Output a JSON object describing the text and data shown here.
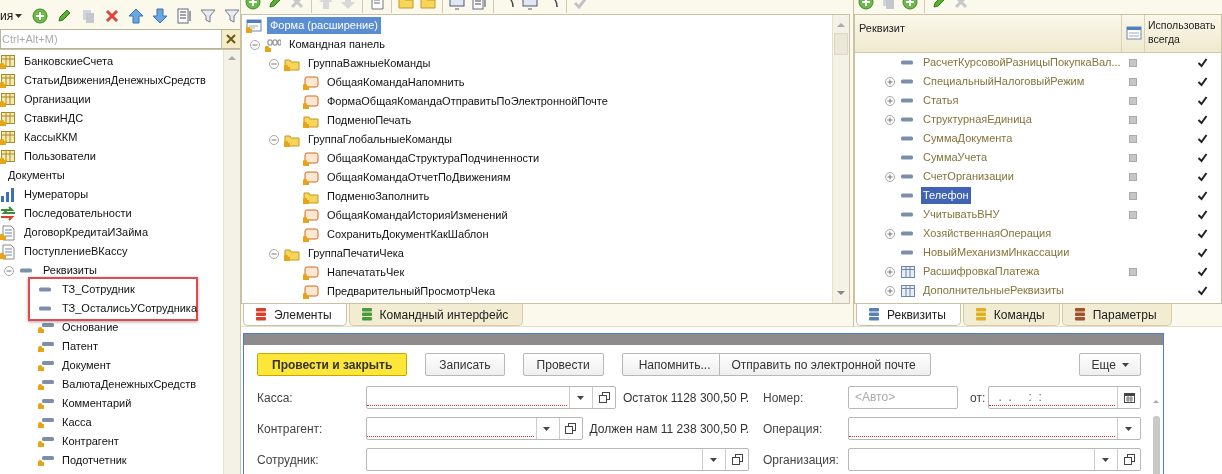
{
  "navigator": {
    "menu_label": "ия",
    "search": {
      "placeholder": "Ctrl+Alt+M)"
    },
    "items": [
      {
        "label": "БанковскиеСчета",
        "kind": "catalog"
      },
      {
        "label": "СтатьиДвиженияДенежныхСредств",
        "kind": "catalog"
      },
      {
        "label": "Организации",
        "kind": "catalog"
      },
      {
        "label": "СтавкиНДС",
        "kind": "catalog"
      },
      {
        "label": "КассыККМ",
        "kind": "catalog"
      },
      {
        "label": "Пользователи",
        "kind": "catalog"
      },
      {
        "label": "Документы",
        "kind": "section"
      },
      {
        "label": "Нумераторы",
        "kind": "numerator"
      },
      {
        "label": "Последовательности",
        "kind": "sequence"
      },
      {
        "label": "ДоговорКредитаИЗайма",
        "kind": "document"
      },
      {
        "label": "ПоступлениеВКассу",
        "kind": "document",
        "children": [
          {
            "label": "Реквизиты",
            "kind": "attr",
            "expanded": true,
            "children": [
              {
                "label": "ТЗ_Сотрудник",
                "kind": "attr",
                "highlighted": true
              },
              {
                "label": "ТЗ_ОсталисьУСотрудника",
                "kind": "attr",
                "highlighted": true
              },
              {
                "label": "Основание",
                "kind": "attr_key",
                "highlighted": false
              },
              {
                "label": "Патент",
                "kind": "attr_key",
                "highlighted": false
              },
              {
                "label": "Документ",
                "kind": "attr_key",
                "highlighted": false
              },
              {
                "label": "ВалютаДенежныхСредств",
                "kind": "attr_key",
                "highlighted": false
              },
              {
                "label": "Комментарий",
                "kind": "attr_key",
                "highlighted": false
              },
              {
                "label": "Касса",
                "kind": "attr_key",
                "highlighted": false
              },
              {
                "label": "Контрагент",
                "kind": "attr_key",
                "highlighted": false
              },
              {
                "label": "Подотчетник",
                "kind": "attr_key",
                "highlighted": false
              }
            ]
          }
        ]
      }
    ]
  },
  "form_structure": {
    "items": [
      {
        "label": "Форма (расширение)",
        "kind": "form",
        "selected": true,
        "children": [
          {
            "label": "Командная панель",
            "kind": "command_bar",
            "selected": false,
            "expanded": true,
            "children": [
              {
                "label": "ГруппаВажныеКоманды",
                "kind": "group",
                "selected": false,
                "expanded": true,
                "children": [
                  {
                    "label": "ОбщаяКомандаНапомнить",
                    "kind": "command",
                    "selected": false
                  },
                  {
                    "label": "ФормаОбщаяКомандаОтправитьПоЭлектроннойПочте",
                    "kind": "command",
                    "selected": false
                  },
                  {
                    "label": "ПодменюПечать",
                    "kind": "group",
                    "selected": false
                  }
                ]
              },
              {
                "label": "ГруппаГлобальныеКоманды",
                "kind": "group",
                "selected": false,
                "expanded": true,
                "children": [
                  {
                    "label": "ОбщаяКомандаСтруктураПодчиненности",
                    "kind": "command",
                    "selected": false
                  },
                  {
                    "label": "ОбщаяКомандаОтчетПоДвижениям",
                    "kind": "command",
                    "selected": false
                  },
                  {
                    "label": "ПодменюЗаполнить",
                    "kind": "group",
                    "selected": false
                  },
                  {
                    "label": "ОбщаяКомандаИсторияИзменений",
                    "kind": "command",
                    "selected": false
                  },
                  {
                    "label": "СохранитьДокументКакШаблон",
                    "kind": "command",
                    "selected": false
                  }
                ]
              },
              {
                "label": "ГруппаПечатиЧека",
                "kind": "group",
                "selected": false,
                "expanded": true,
                "children": [
                  {
                    "label": "НапечататьЧек",
                    "kind": "command",
                    "selected": false
                  },
                  {
                    "label": "ПредварительныйПросмотрЧека",
                    "kind": "command",
                    "selected": false
                  }
                ]
              }
            ]
          }
        ]
      }
    ],
    "tabs": [
      {
        "label": "Элементы",
        "selected": true
      },
      {
        "label": "Командный интерфейс",
        "selected": false
      }
    ]
  },
  "attributes": {
    "columns": [
      "Реквизит",
      "Использовать всегда"
    ],
    "rows": [
      {
        "label": "РасчетКурсовойРазницыПокупкаВал...",
        "kind": "attr",
        "expandable": false,
        "column_2": true,
        "checked": true,
        "selected": false
      },
      {
        "label": "СпециальныйНалоговыйРежим",
        "kind": "attr",
        "expandable": true,
        "column_2": true,
        "checked": true,
        "selected": false
      },
      {
        "label": "Статья",
        "kind": "attr",
        "expandable": true,
        "column_2": true,
        "checked": true,
        "selected": false
      },
      {
        "label": "СтруктурнаяЕдиница",
        "kind": "attr",
        "expandable": true,
        "column_2": true,
        "checked": true,
        "selected": false
      },
      {
        "label": "СуммаДокумента",
        "kind": "attr",
        "expandable": false,
        "column_2": true,
        "checked": true,
        "selected": false
      },
      {
        "label": "СуммаУчета",
        "kind": "attr",
        "expandable": false,
        "column_2": true,
        "checked": true,
        "selected": false
      },
      {
        "label": "СчетОрганизации",
        "kind": "attr",
        "expandable": true,
        "column_2": true,
        "checked": true,
        "selected": false
      },
      {
        "label": "Телефон",
        "kind": "attr",
        "expandable": false,
        "column_2": true,
        "checked": true,
        "selected": true
      },
      {
        "label": "УчитыватьВНУ",
        "kind": "attr",
        "expandable": false,
        "column_2": true,
        "checked": true,
        "selected": false
      },
      {
        "label": "ХозяйственнаяОперация",
        "kind": "attr",
        "expandable": true,
        "column_2": false,
        "checked": true,
        "selected": false
      },
      {
        "label": "НовыйМеханизмИнкассации",
        "kind": "attr",
        "expandable": false,
        "column_2": false,
        "checked": true,
        "selected": false
      },
      {
        "label": "РасшифровкаПлатежа",
        "kind": "table",
        "expandable": true,
        "column_2": true,
        "checked": true,
        "selected": false
      },
      {
        "label": "ДополнительныеРеквизиты",
        "kind": "table",
        "expandable": true,
        "column_2": false,
        "checked": true,
        "selected": false
      }
    ],
    "tabs": [
      {
        "label": "Реквизиты",
        "selected": true
      },
      {
        "label": "Команды",
        "selected": false
      },
      {
        "label": "Параметры",
        "selected": false
      }
    ]
  },
  "form_preview": {
    "buttons": [
      {
        "label": "Провести и закрыть",
        "kind": "default"
      },
      {
        "label": "Записать",
        "kind": "normal"
      },
      {
        "label": "Провести",
        "kind": "normal"
      },
      {
        "label": "Напомнить...",
        "kind": "group_start"
      },
      {
        "label": "Отправить по электронной почте",
        "kind": "group_end"
      },
      {
        "label": "Еще",
        "kind": "menu"
      }
    ],
    "rows": [
      {
        "left": {
          "label": "Касса:",
          "field": {
            "required": true,
            "dropdown": true,
            "open_button": true
          },
          "note": "Остаток 1128 300,50 Р."
        },
        "right": {
          "label": "Номер:",
          "items": [
            {
              "kind": "number",
              "placeholder": "<Авто>"
            },
            {
              "kind": "text",
              "text": "от:"
            },
            {
              "kind": "date",
              "value": " .  .     :  :",
              "required": true
            }
          ]
        }
      },
      {
        "left": {
          "label": "Контрагент:",
          "field": {
            "required": true,
            "dropdown": true,
            "open_button": true
          },
          "note": "Должен нам 11 238 300,50 Р."
        },
        "right": {
          "label": "Операция:",
          "items": [
            {
              "kind": "combo",
              "required": true,
              "dropdown": true,
              "open_button": false
            }
          ]
        }
      },
      {
        "left": {
          "label": "Сотрудник:",
          "field": {
            "required": false,
            "dropdown": true,
            "open_button": true
          }
        },
        "right": {
          "label": "Организация:",
          "items": [
            {
              "kind": "combo",
              "required": false,
              "dropdown": true,
              "open_button": true
            }
          ]
        }
      }
    ]
  }
}
